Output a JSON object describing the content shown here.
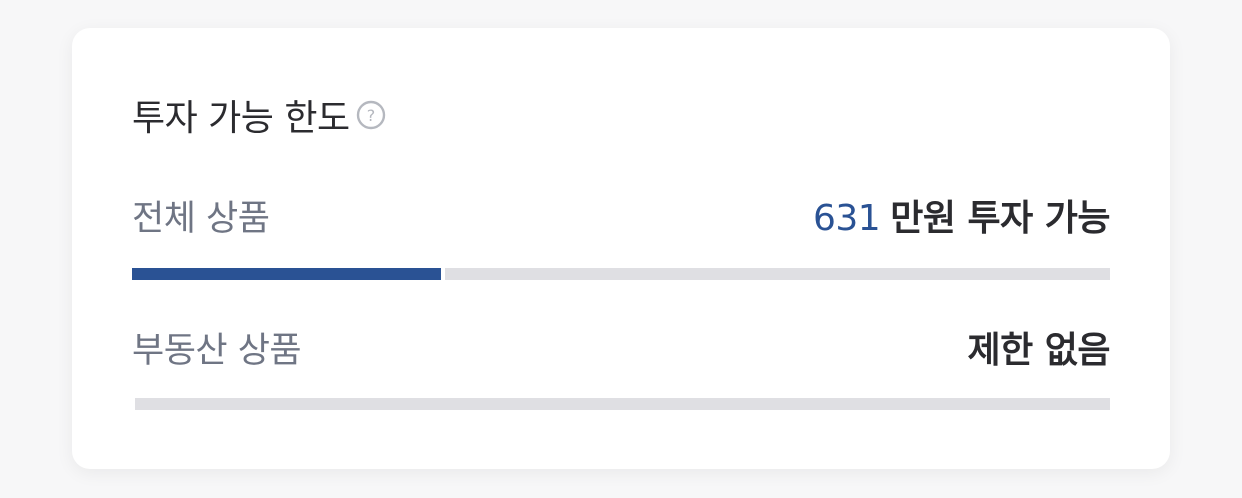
{
  "limit_card": {
    "title": "투자 가능 한도",
    "help_icon": "question-circle-icon",
    "rows": [
      {
        "label": "전체 상품",
        "amount": "631",
        "value_suffix": "만원 투자 가능",
        "progress_fraction": 0.316,
        "fill_color": "#2a5294",
        "track_color": "#dfdfe3"
      },
      {
        "label": "부동산 상품",
        "value": "제한 없음",
        "progress_fraction": 0,
        "track_color": "#dfdfe3"
      }
    ]
  }
}
